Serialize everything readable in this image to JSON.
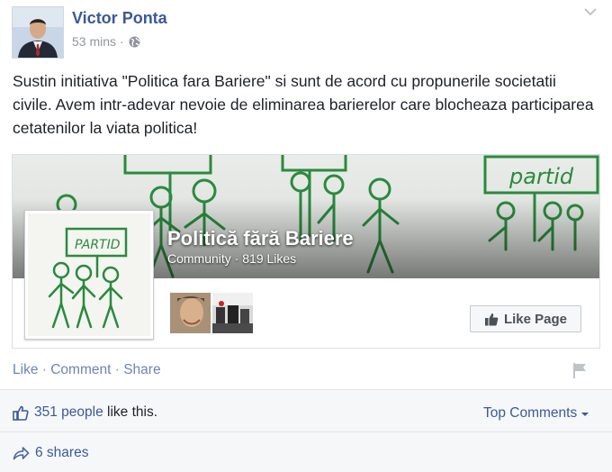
{
  "post": {
    "author": "Victor Ponta",
    "time": "53 mins",
    "time_separator": "·",
    "audience_icon": "globe-icon",
    "text": "Sustin initiativa \"Politica fara Bariere\" si sunt de acord cu propunerile societatii civile. Avem intr-adevar nevoie de eliminarea barierelor care blocheaza participarea cetatenilor la viata politica!"
  },
  "page_card": {
    "name": "Politică fără Bariere",
    "category": "Community",
    "sub_separator": "·",
    "likes": "819 Likes",
    "cover_sign": "partid",
    "profile_sign": "PARTID",
    "like_button": "Like Page",
    "like_icon": "thumbs-up-icon"
  },
  "actions": {
    "like": "Like",
    "comment": "Comment",
    "share": "Share",
    "separator": "·"
  },
  "summary": {
    "likes_link": "351 people",
    "likes_suffix": "like this.",
    "top_comments": "Top Comments",
    "shares": "6 shares"
  },
  "colors": {
    "link": "#3b5998",
    "action_link": "#6d84b4",
    "marker_green": "#2a8a3e"
  }
}
